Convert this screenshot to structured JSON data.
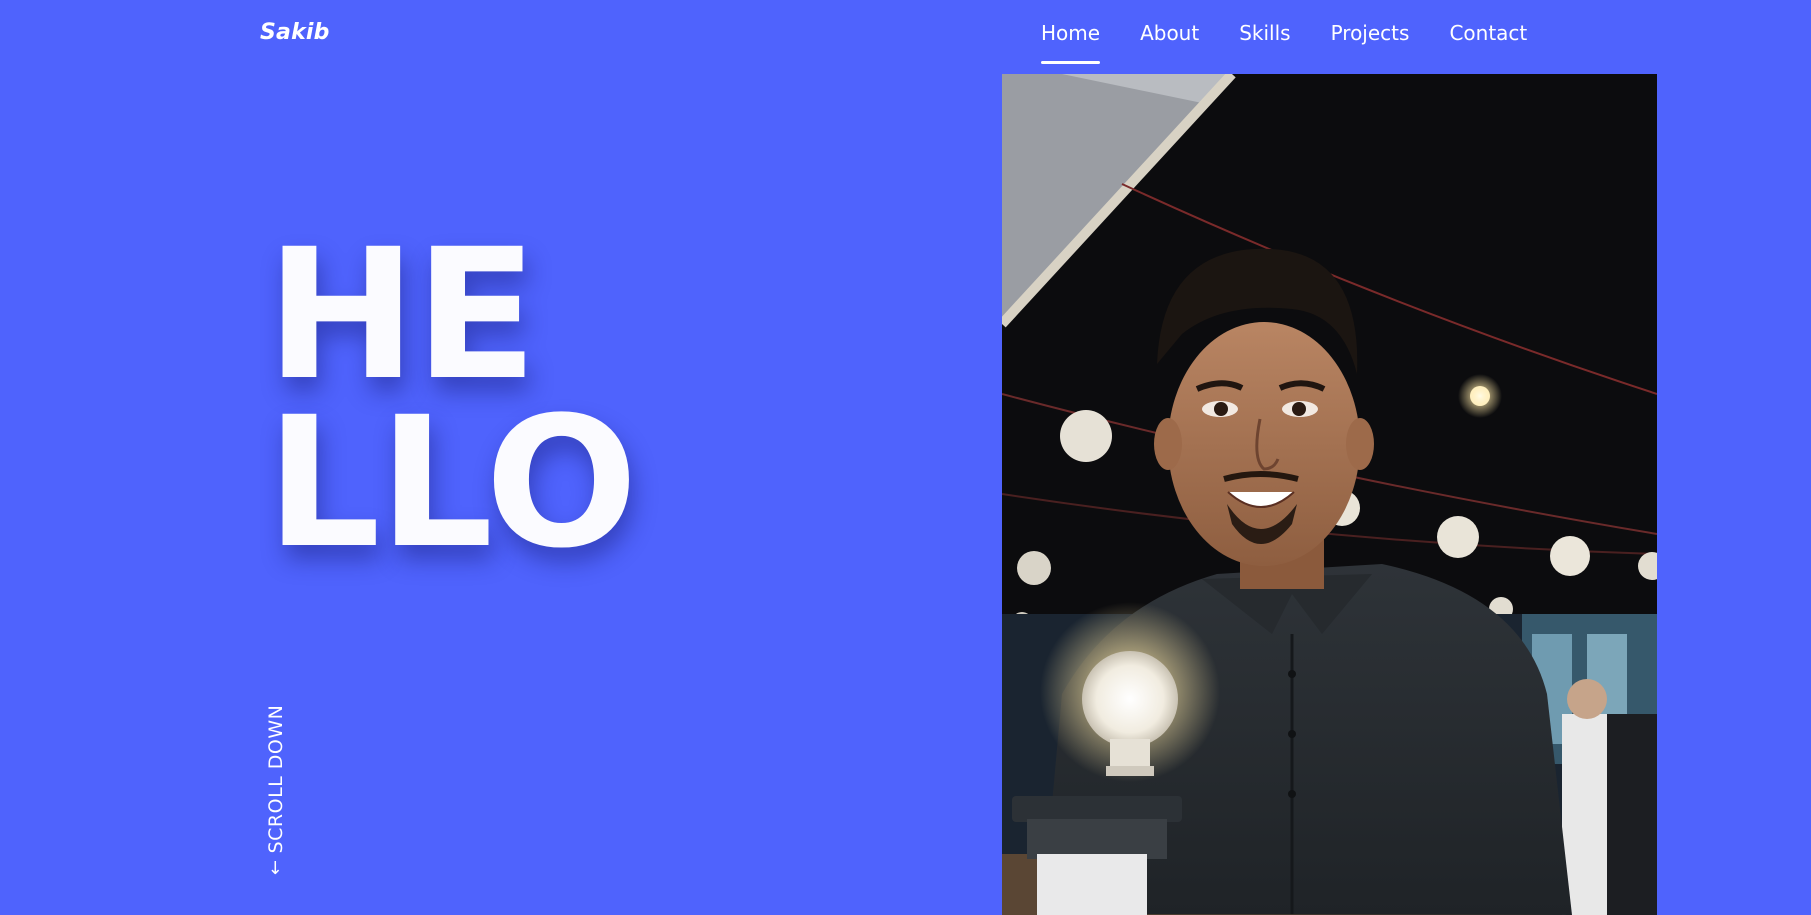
{
  "header": {
    "logo": "Sakib",
    "nav": [
      {
        "label": "Home",
        "active": true
      },
      {
        "label": "About",
        "active": false
      },
      {
        "label": "Skills",
        "active": false
      },
      {
        "label": "Projects",
        "active": false
      },
      {
        "label": "Contact",
        "active": false
      }
    ]
  },
  "hero": {
    "line1": "HE",
    "line2": "LLO",
    "scroll_label": "SCROLL DOWN",
    "scroll_icon": "arrow-down-icon"
  },
  "colors": {
    "background": "#4f63fd",
    "text": "#ffffff"
  }
}
